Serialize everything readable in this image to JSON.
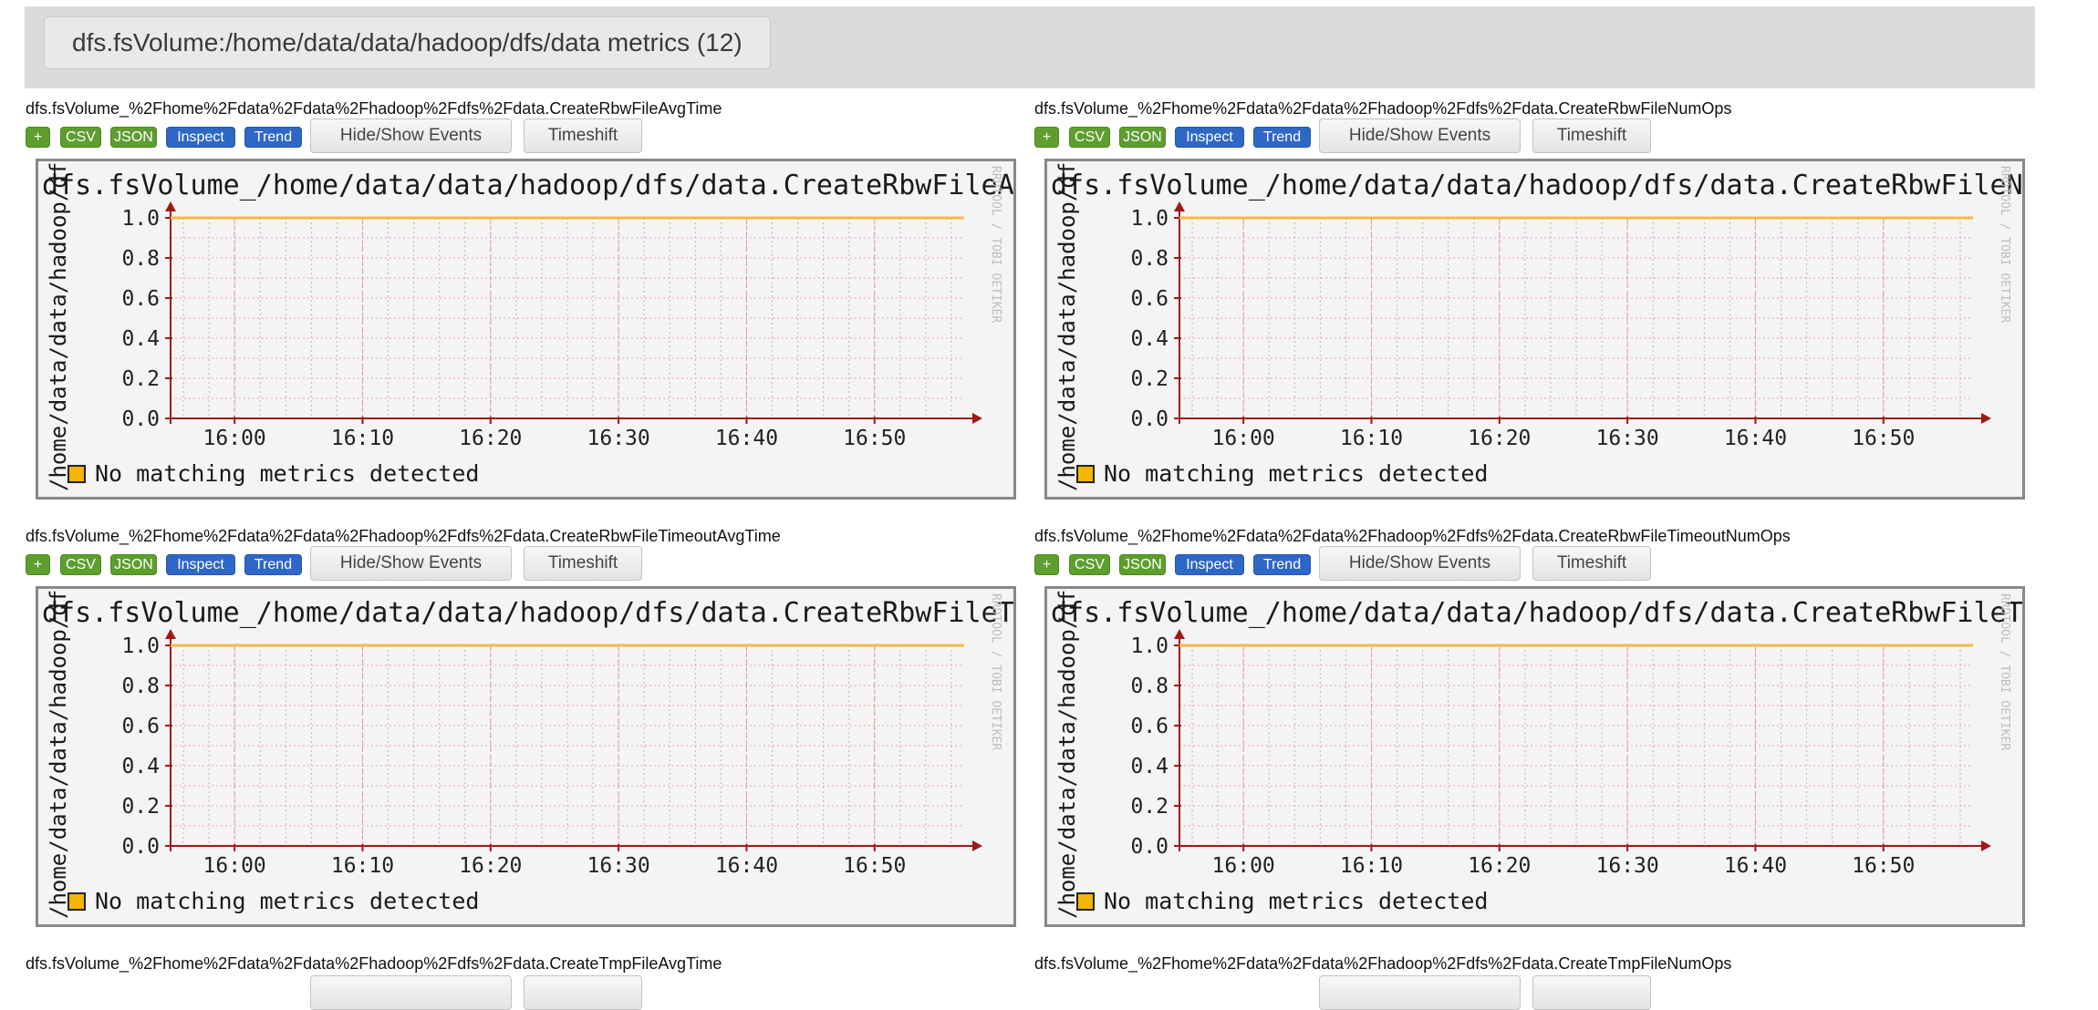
{
  "section": {
    "title": "dfs.fsVolume:/home/data/data/hadoop/dfs/data metrics (12)"
  },
  "buttons": {
    "plus": "+",
    "csv": "CSV",
    "json": "JSON",
    "inspect": "Inspect",
    "trend": "Trend",
    "hide_show_events": "Hide/Show Events",
    "timeshift": "Timeshift"
  },
  "colors": {
    "background": "#f4f4f4",
    "series_line": "#f5b94b",
    "grid": "#e6a3a3",
    "axis": "#a01818",
    "legend_swatch": "#f4b400",
    "tag_green": "#5d9e2e",
    "tag_blue": "#2f67c7"
  },
  "graphs": [
    {
      "metric": "dfs.fsVolume_%2Fhome%2Fdata%2Fdata%2Fhadoop%2Fdfs%2Fdata.CreateRbwFileAvgTime",
      "title": "dfs.fsVolume_/home/data/data/hadoop/dfs/data.CreateRbwFileAvgTime",
      "ylabel": "/home/data/data/hadoop/dfs/data",
      "watermark": "RRDTOOL / TOBI OETIKER",
      "legend": "No matching metrics detected",
      "chart_data": {
        "type": "line",
        "x": [
          "15:55",
          "16:57"
        ],
        "xticks": [
          "16:00",
          "16:10",
          "16:20",
          "16:30",
          "16:40",
          "16:50"
        ],
        "yticks": [
          "1.0",
          "0.8",
          "0.6",
          "0.4",
          "0.2",
          "0.0"
        ],
        "ylim": [
          0,
          1
        ],
        "series": [
          {
            "values": [
              1.0,
              1.0
            ]
          }
        ],
        "grid": true
      }
    },
    {
      "metric": "dfs.fsVolume_%2Fhome%2Fdata%2Fdata%2Fhadoop%2Fdfs%2Fdata.CreateRbwFileNumOps",
      "title": "dfs.fsVolume_/home/data/data/hadoop/dfs/data.CreateRbwFileNumOps",
      "ylabel": "/home/data/data/hadoop/dfs/data",
      "watermark": "RRDTOOL / TOBI OETIKER",
      "legend": "No matching metrics detected",
      "chart_data": {
        "type": "line",
        "x": [
          "15:55",
          "16:57"
        ],
        "xticks": [
          "16:00",
          "16:10",
          "16:20",
          "16:30",
          "16:40",
          "16:50"
        ],
        "yticks": [
          "1.0",
          "0.8",
          "0.6",
          "0.4",
          "0.2",
          "0.0"
        ],
        "ylim": [
          0,
          1
        ],
        "series": [
          {
            "values": [
              1.0,
              1.0
            ]
          }
        ],
        "grid": true
      }
    },
    {
      "metric": "dfs.fsVolume_%2Fhome%2Fdata%2Fdata%2Fhadoop%2Fdfs%2Fdata.CreateRbwFileTimeoutAvgTime",
      "title": "dfs.fsVolume_/home/data/data/hadoop/dfs/data.CreateRbwFileTimeoutAvgTime",
      "ylabel": "/home/data/data/hadoop/dfs/data",
      "watermark": "RRDTOOL / TOBI OETIKER",
      "legend": "No matching metrics detected",
      "chart_data": {
        "type": "line",
        "x": [
          "15:55",
          "16:57"
        ],
        "xticks": [
          "16:00",
          "16:10",
          "16:20",
          "16:30",
          "16:40",
          "16:50"
        ],
        "yticks": [
          "1.0",
          "0.8",
          "0.6",
          "0.4",
          "0.2",
          "0.0"
        ],
        "ylim": [
          0,
          1
        ],
        "series": [
          {
            "values": [
              1.0,
              1.0
            ]
          }
        ],
        "grid": true
      }
    },
    {
      "metric": "dfs.fsVolume_%2Fhome%2Fdata%2Fdata%2Fhadoop%2Fdfs%2Fdata.CreateRbwFileTimeoutNumOps",
      "title": "dfs.fsVolume_/home/data/data/hadoop/dfs/data.CreateRbwFileTimeoutNumOps",
      "ylabel": "/home/data/data/hadoop/dfs/data",
      "watermark": "RRDTOOL / TOBI OETIKER",
      "legend": "No matching metrics detected",
      "chart_data": {
        "type": "line",
        "x": [
          "15:55",
          "16:57"
        ],
        "xticks": [
          "16:00",
          "16:10",
          "16:20",
          "16:30",
          "16:40",
          "16:50"
        ],
        "yticks": [
          "1.0",
          "0.8",
          "0.6",
          "0.4",
          "0.2",
          "0.0"
        ],
        "ylim": [
          0,
          1
        ],
        "series": [
          {
            "values": [
              1.0,
              1.0
            ]
          }
        ],
        "grid": true
      }
    }
  ],
  "next_metrics": [
    "dfs.fsVolume_%2Fhome%2Fdata%2Fdata%2Fhadoop%2Fdfs%2Fdata.CreateTmpFileAvgTime",
    "dfs.fsVolume_%2Fhome%2Fdata%2Fdata%2Fhadoop%2Fdfs%2Fdata.CreateTmpFileNumOps"
  ]
}
